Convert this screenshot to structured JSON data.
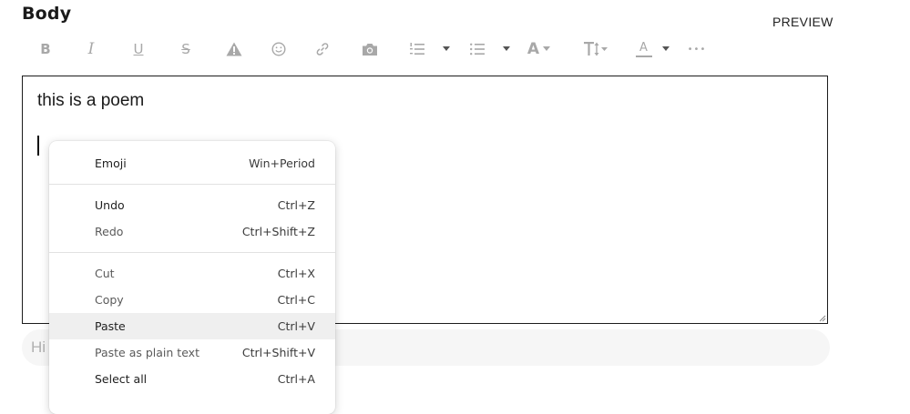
{
  "header": {
    "title": "Body",
    "preview_label": "PREVIEW"
  },
  "toolbar": {
    "buttons": [
      {
        "name": "bold-button",
        "glyph": "B"
      },
      {
        "name": "italic-button",
        "glyph": "I"
      },
      {
        "name": "underline-button",
        "glyph": "U"
      },
      {
        "name": "strikethrough-button",
        "glyph": "S"
      }
    ],
    "icons": [
      "warning-icon",
      "emoji-icon",
      "link-icon",
      "camera-icon",
      "numbered-list-icon",
      "bullet-list-icon",
      "font-icon",
      "text-size-icon",
      "text-color-icon",
      "more-icon"
    ],
    "font_glyph": "A",
    "color_glyph": "A",
    "more_glyph": "•••"
  },
  "editor": {
    "text": "this is a poem"
  },
  "hint_field": {
    "placeholder": "Hi"
  },
  "context_menu": {
    "items": [
      {
        "label": "Emoji",
        "shortcut": "Win+Period"
      },
      {
        "label": "Undo",
        "shortcut": "Ctrl+Z"
      },
      {
        "label": "Redo",
        "shortcut": "Ctrl+Shift+Z"
      },
      {
        "label": "Cut",
        "shortcut": "Ctrl+X"
      },
      {
        "label": "Copy",
        "shortcut": "Ctrl+C"
      },
      {
        "label": "Paste",
        "shortcut": "Ctrl+V"
      },
      {
        "label": "Paste as plain text",
        "shortcut": "Ctrl+Shift+V"
      },
      {
        "label": "Select all",
        "shortcut": "Ctrl+A"
      }
    ],
    "highlighted": "Paste"
  },
  "colors": {
    "icon_gray": "#aaaaaa",
    "border": "#1c1c1c",
    "menu_hover": "#efefef"
  }
}
